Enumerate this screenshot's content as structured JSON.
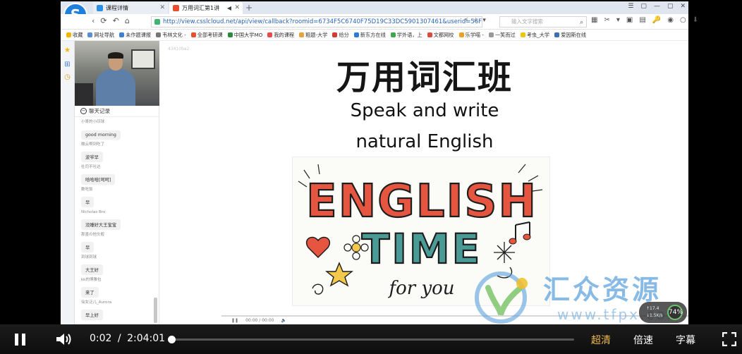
{
  "browser": {
    "logo_letter": "S",
    "tabs": [
      {
        "label": "课程详情"
      },
      {
        "label": "万用词汇第1讲",
        "speaker": "◀",
        "close": "✕"
      }
    ],
    "tab1_close": "✕",
    "new_tab": "+",
    "window_buttons": [
      "☰",
      "▢",
      "—",
      "▢",
      "✕"
    ],
    "nav_icons": [
      "‹",
      "⟳",
      "↶",
      "⌂"
    ],
    "url": "http://view.csslcloud.net/api/view/callback?roomid=6734F5C6740F75D19C33DC5901307461&userid=56FF",
    "url_icons": [
      "⚡",
      "☆",
      "▾"
    ],
    "search_placeholder": "输入文字搜索",
    "search_icon": "⌕",
    "tool_icons": [
      "▦",
      "✂",
      "▾",
      "▣",
      "▤",
      "🔑",
      "◉",
      "○",
      "⬇"
    ],
    "bookmarks": [
      {
        "label": "收藏",
        "color": "#f2b400"
      },
      {
        "label": "网址导航",
        "color": "#5a8fd6"
      },
      {
        "label": "未作题课报",
        "color": "#3f7fd0"
      },
      {
        "label": "韦林文化 -",
        "color": "#777777"
      },
      {
        "label": "全部考研课",
        "color": "#e8502d"
      },
      {
        "label": "中国大学MO",
        "color": "#2b8a3e"
      },
      {
        "label": "我的课程",
        "color": "#e84a4a"
      },
      {
        "label": "粗题-大学",
        "color": "#e6a23c"
      },
      {
        "label": "给分",
        "color": "#d6392f"
      },
      {
        "label": "新东方在线",
        "color": "#2d79d6"
      },
      {
        "label": "学外语，上",
        "color": "#3aa84a"
      },
      {
        "label": "文都网校",
        "color": "#e04a3c"
      },
      {
        "label": "乐学喵 -",
        "color": "#f0a020"
      },
      {
        "label": "一笑而过",
        "color": "#999999"
      },
      {
        "label": "考虫_大学",
        "color": "#f1c40f"
      },
      {
        "label": "爱因斯在线",
        "color": "#3b6fb6"
      }
    ],
    "sidebar_icons": [
      "★",
      "⊞",
      "◷"
    ]
  },
  "chat": {
    "header": "聊天记录",
    "messages": [
      {
        "user": "小哥的小印球",
        "text": "good morning"
      },
      {
        "user": "微云啊到吃了",
        "text": "波爷早"
      },
      {
        "user": "社司不吐达",
        "text": "哈哈哈[呵呵]"
      },
      {
        "user": "数吃饭",
        "text": "早"
      },
      {
        "user": "Nicholas Bro",
        "text": "没睡好大王宝宝"
      },
      {
        "user": "那墨の他头般",
        "text": "早"
      },
      {
        "user": "到球到球",
        "text": "大王好"
      },
      {
        "user": "kk的博雅包",
        "text": "来了"
      },
      {
        "user": "仙女泛儿_Aurora",
        "text": "早上好"
      }
    ]
  },
  "slide": {
    "stamp": "43410ba2",
    "title": "万用词汇班",
    "subtitle1": "Speak and write",
    "subtitle2": "natural English",
    "poster": {
      "line1": "ENGLISH",
      "line2": "TIME",
      "line3": "for you"
    }
  },
  "watermark": {
    "text": "汇众资源",
    "url": "www.tfpx.com"
  },
  "net_badge": {
    "percent": "74%",
    "up": "↑17.4",
    "down": "↓1.5K/s"
  },
  "inner_player": {
    "time": "00:00 / 00:00"
  },
  "player": {
    "current_time": "0:02",
    "separator": "/",
    "duration": "2:04:01",
    "progress_fraction": 0.0,
    "quality": "超清",
    "speed": "倍速",
    "subtitles": "字幕",
    "quality_color": "#f0b94a"
  }
}
